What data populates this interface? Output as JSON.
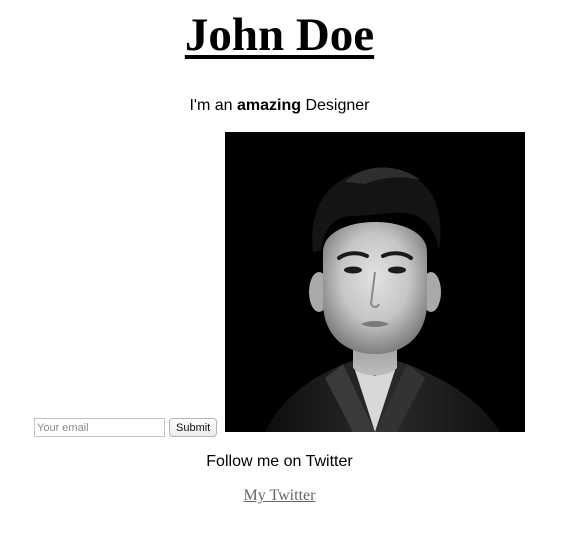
{
  "header": {
    "name": "John Doe"
  },
  "tagline": {
    "prefix": "I'm an ",
    "emphasis": "amazing",
    "suffix": " Designer"
  },
  "portrait": {
    "background": "#000000",
    "style": "black-and-white"
  },
  "subscribe": {
    "email_placeholder": "Your email",
    "email_value": "",
    "submit_label": "Submit"
  },
  "social": {
    "follow_text": "Follow me on Twitter",
    "twitter_link_text": "My Twitter",
    "link_color": "#666666"
  }
}
